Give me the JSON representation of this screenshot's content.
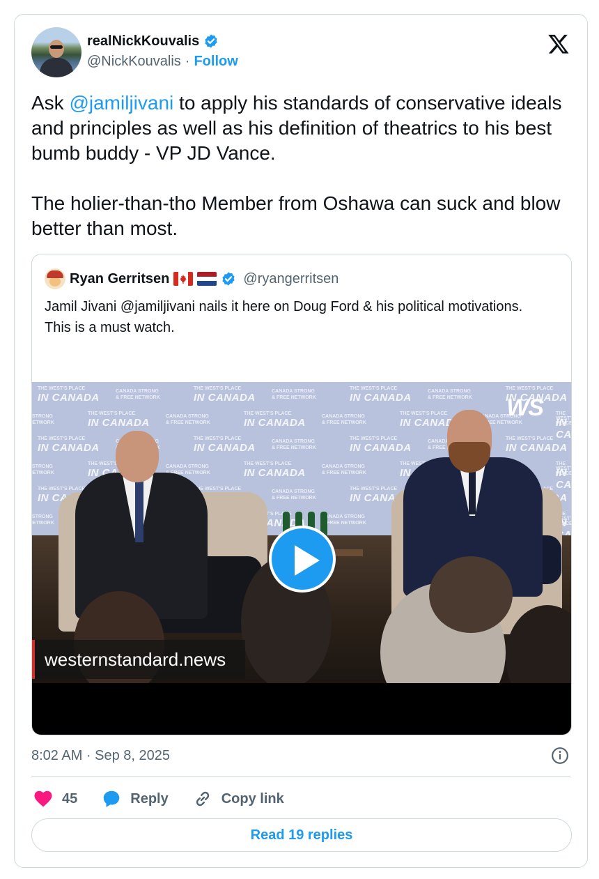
{
  "author": {
    "display_name": "realNickKouvalis",
    "handle": "@NickKouvalis",
    "separator": "·",
    "follow_label": "Follow"
  },
  "tweet": {
    "text_parts": [
      {
        "type": "text",
        "value": "Ask "
      },
      {
        "type": "mention",
        "value": "@jamiljivani"
      },
      {
        "type": "text",
        "value": " to apply his standards of conservative ideals and principles as well as his definition of theatrics to his best bumb buddy - VP JD Vance.\n\nThe holier-than-tho Member from Oshawa can suck and blow better than most."
      }
    ]
  },
  "quote": {
    "display_name": "Ryan Gerritsen",
    "handle": "@ryangerritsen",
    "flags": [
      "canada-flag-icon",
      "netherlands-flag-icon"
    ],
    "text": "Jamil Jivani @jamiljivani nails it here on Doug Ford & his political motivations.\nThis is a must watch.",
    "video": {
      "watermark": "WS",
      "lower_third": "westernstandard.news",
      "backdrop_line1": "THE WEST'S PLACE",
      "backdrop_line2": "IN CANADA",
      "backdrop_line3": "CANADA STRONG",
      "backdrop_line4": "& FREE NETWORK"
    }
  },
  "timestamp": "8:02 AM · Sep 8, 2025",
  "actions": {
    "like_count": "45",
    "reply_label": "Reply",
    "copy_link_label": "Copy link"
  },
  "read_replies_label": "Read 19 replies",
  "colors": {
    "accent": "#1d9bf0",
    "heart": "#f91880",
    "text": "#0f1419",
    "muted": "#536471",
    "border": "#cfd9de"
  }
}
